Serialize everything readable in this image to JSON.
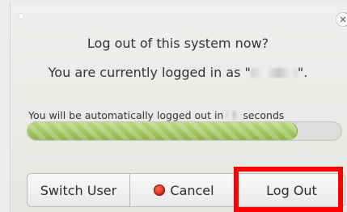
{
  "dialog": {
    "title": "Log out of this system now?",
    "subtitle_prefix": "You are currently logged in as \"",
    "subtitle_suffix": "\".",
    "countdown_prefix": "You will be automatically logged out in",
    "countdown_suffix": "seconds",
    "progress_fraction": 0.86,
    "close_icon": "close-icon"
  },
  "buttons": {
    "switch_user": "Switch User",
    "cancel": "Cancel",
    "log_out": "Log Out"
  },
  "colors": {
    "progress": "#9cc25a",
    "highlight": "#ff0000",
    "cancel_icon": "#d8261b"
  }
}
